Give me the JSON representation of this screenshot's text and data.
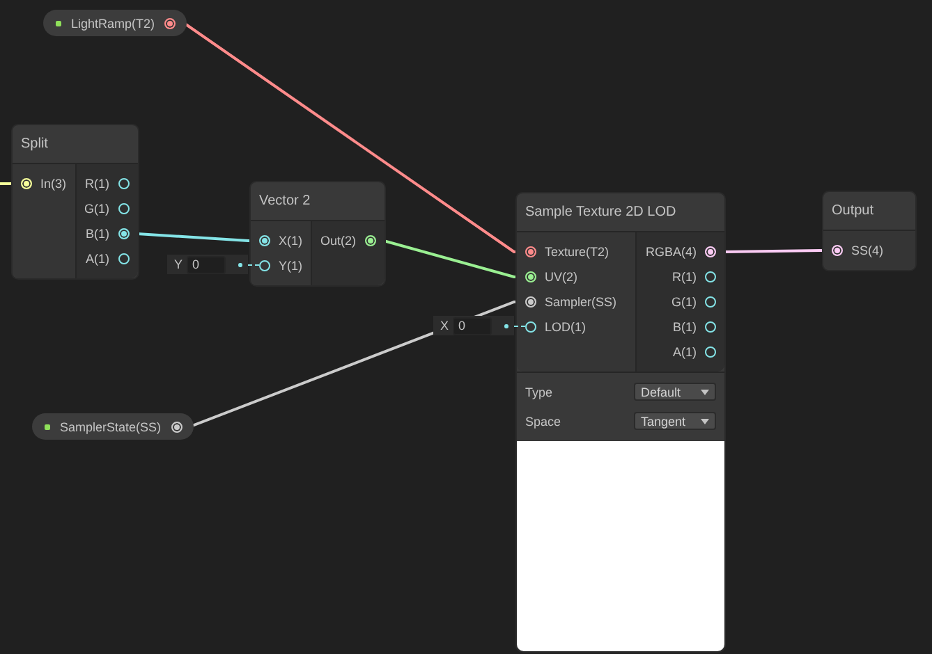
{
  "nodes": [
    {
      "kind": "property",
      "label": "LightRamp(T2)",
      "port": {
        "color": "#ff8b8b",
        "connected": true
      }
    },
    {
      "kind": "node",
      "title": "Split",
      "inputs": [
        {
          "label": "In(3)",
          "color": "#f6ff9a",
          "connected": true
        }
      ],
      "outputs": [
        {
          "label": "R(1)",
          "color": "#84e4e7",
          "connected": false
        },
        {
          "label": "G(1)",
          "color": "#84e4e7",
          "connected": false
        },
        {
          "label": "B(1)",
          "color": "#84e4e7",
          "connected": true
        },
        {
          "label": "A(1)",
          "color": "#84e4e7",
          "connected": false
        }
      ]
    },
    {
      "kind": "node",
      "title": "Vector 2",
      "inputs": [
        {
          "label": "X(1)",
          "color": "#84e4e7",
          "connected": true
        },
        {
          "label": "Y(1)",
          "color": "#84e4e7",
          "connected": false,
          "inline": {
            "axis": "Y",
            "value": "0"
          }
        }
      ],
      "outputs": [
        {
          "label": "Out(2)",
          "color": "#9aef92",
          "connected": true
        }
      ]
    },
    {
      "kind": "node",
      "title": "Sample Texture 2D LOD",
      "inputs": [
        {
          "label": "Texture(T2)",
          "color": "#ff8b8b",
          "connected": true
        },
        {
          "label": "UV(2)",
          "color": "#9aef92",
          "connected": true
        },
        {
          "label": "Sampler(SS)",
          "color": "#cbcbcb",
          "connected": true
        },
        {
          "label": "LOD(1)",
          "color": "#84e4e7",
          "connected": false,
          "inline": {
            "axis": "X",
            "value": "0"
          }
        }
      ],
      "outputs": [
        {
          "label": "RGBA(4)",
          "color": "#fbcbf4",
          "connected": true
        },
        {
          "label": "R(1)",
          "color": "#84e4e7",
          "connected": false
        },
        {
          "label": "G(1)",
          "color": "#84e4e7",
          "connected": false
        },
        {
          "label": "B(1)",
          "color": "#84e4e7",
          "connected": false
        },
        {
          "label": "A(1)",
          "color": "#84e4e7",
          "connected": false
        }
      ],
      "settings": [
        {
          "label": "Type",
          "value": "Default"
        },
        {
          "label": "Space",
          "value": "Tangent"
        }
      ],
      "preview": true
    },
    {
      "kind": "node",
      "title": "Output",
      "inputs": [
        {
          "label": "SS(4)",
          "color": "#fbcbf4",
          "connected": true
        }
      ]
    },
    {
      "kind": "property",
      "label": "SamplerState(SS)",
      "port": {
        "color": "#cbcbcb",
        "connected": true
      }
    }
  ]
}
